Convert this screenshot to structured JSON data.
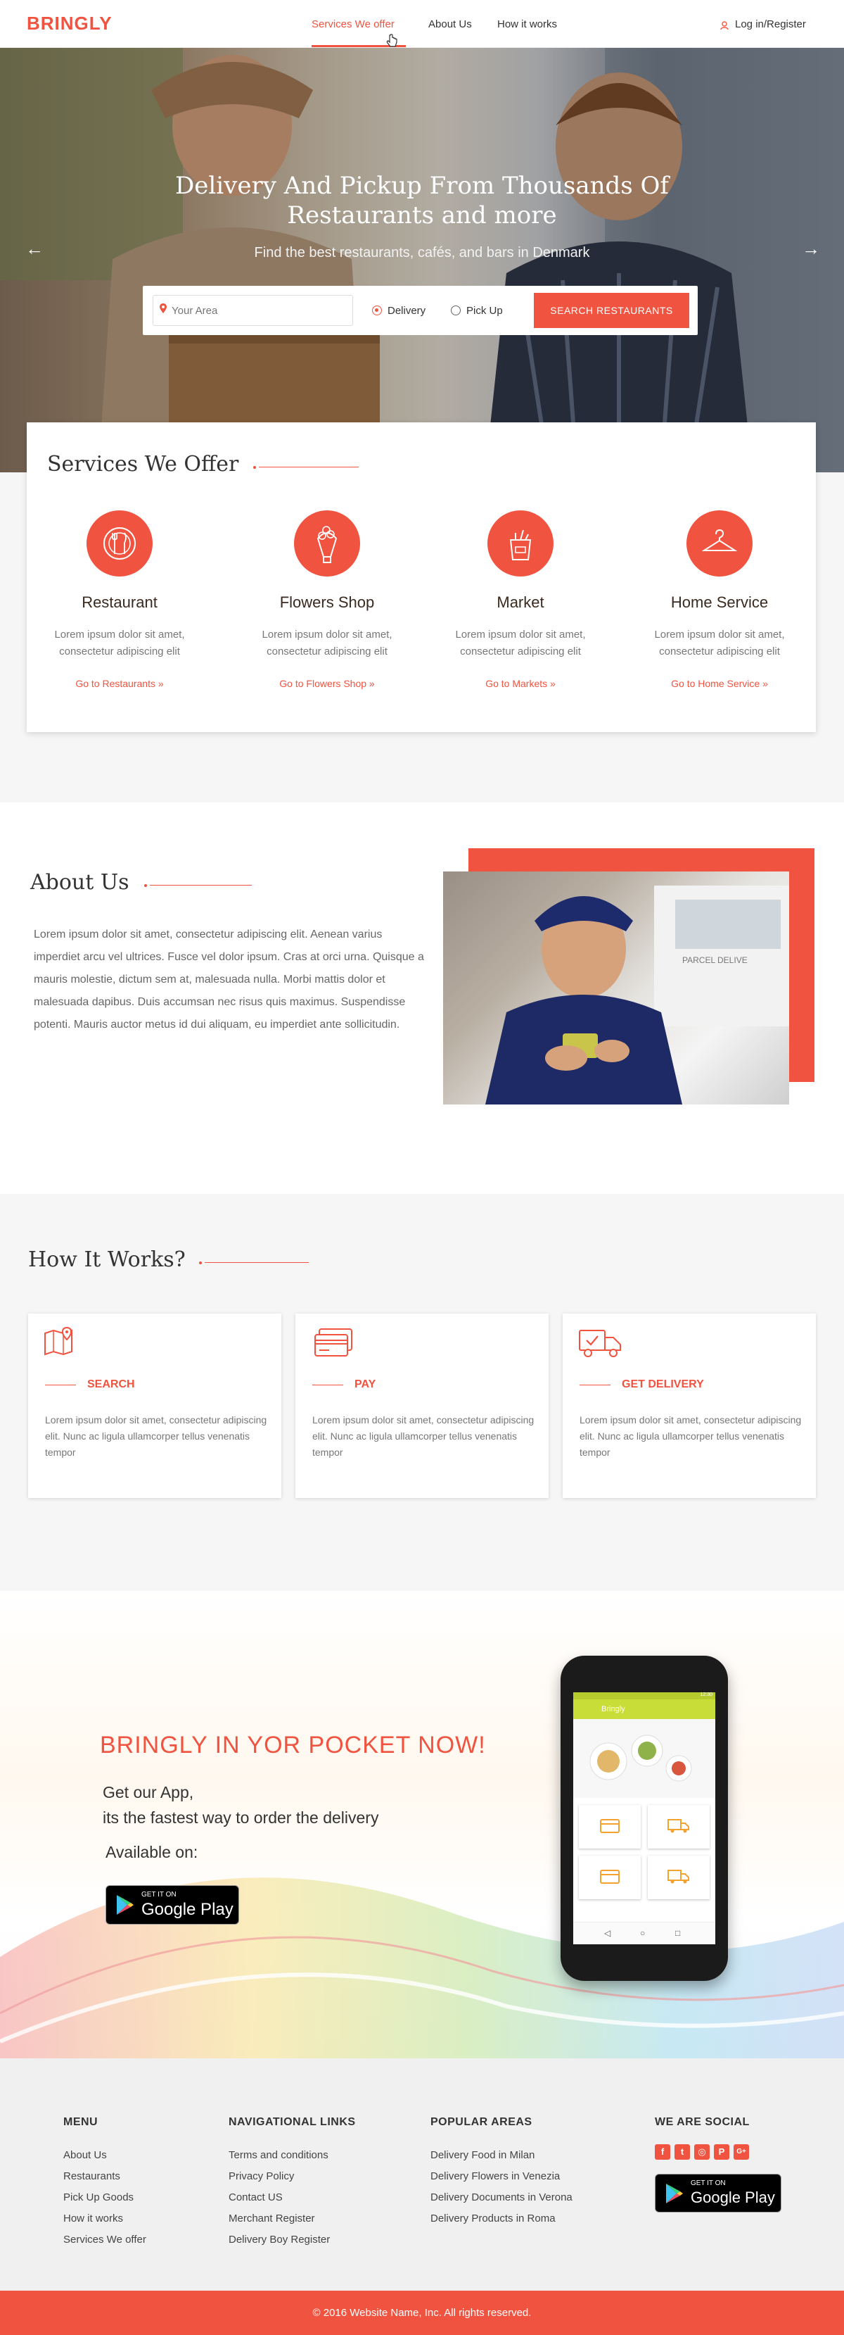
{
  "header": {
    "logo": "BRINGLY",
    "nav": [
      {
        "label": "Services  We offer"
      },
      {
        "label": "About Us"
      },
      {
        "label": "How it works"
      }
    ],
    "login": "Log in/Register"
  },
  "hero": {
    "title": "Delivery And Pickup From Thousands Of Restaurants and more",
    "subtitle": "Find the best restaurants, cafés, and bars in Denmark",
    "search_placeholder": "Your Area",
    "options": [
      "Delivery",
      "Pick Up"
    ],
    "selected_option": "Delivery",
    "search_button": "SEARCH RESTAURANTS",
    "prev_arrow": "←",
    "next_arrow": "→",
    "slides": 3,
    "active_slide": 1
  },
  "services": {
    "title": "Services We Offer",
    "items": [
      {
        "title": "Restaurant",
        "desc": "Lorem ipsum dolor sit amet, consectetur adipiscing elit",
        "link": "Go to Restaurants »",
        "icon": "plate-cutlery-icon"
      },
      {
        "title": "Flowers Shop",
        "desc": "Lorem ipsum dolor sit amet, consectetur adipiscing elit",
        "link": "Go to Flowers Shop »",
        "icon": "bouquet-icon"
      },
      {
        "title": "Market",
        "desc": "Lorem ipsum dolor sit amet, consectetur adipiscing elit",
        "link": "Go to Markets »",
        "icon": "grocery-bag-icon"
      },
      {
        "title": "Home Service",
        "desc": "Lorem ipsum dolor sit amet, consectetur adipiscing elit",
        "link": "Go to Home Service »",
        "icon": "hanger-icon"
      }
    ]
  },
  "about": {
    "title": "About Us",
    "paragraph": "Lorem ipsum dolor sit amet, consectetur adipiscing elit. Aenean varius imperdiet arcu vel ultrices. Fusce vel dolor ipsum. Cras at orci urna. Quisque a mauris molestie, dictum sem at, malesuada nulla. Morbi mattis dolor et malesuada dapibus. Duis accumsan nec risus quis maximus. Suspendisse potenti. Mauris auctor metus id dui aliquam, eu imperdiet ante sollicitudin.",
    "van_text": "PARCEL DELIVE"
  },
  "how": {
    "title": "How It Works?",
    "steps": [
      {
        "label": "SEARCH",
        "desc": "Lorem ipsum dolor sit amet, consectetur adipiscing elit. Nunc ac ligula ullamcorper tellus venenatis tempor",
        "icon": "map-pin-icon"
      },
      {
        "label": "PAY",
        "desc": "Lorem ipsum dolor sit amet, consectetur adipiscing elit. Nunc ac ligula ullamcorper tellus venenatis tempor",
        "icon": "credit-card-icon"
      },
      {
        "label": "GET DELIVERY",
        "desc": "Lorem ipsum dolor sit amet, consectetur adipiscing elit. Nunc ac ligula ullamcorper tellus venenatis tempor",
        "icon": "delivery-truck-icon"
      }
    ]
  },
  "app": {
    "title": "BRINGLY IN YOR POCKET NOW!",
    "line1": "Get our App,",
    "line2": "its the fastest way to order the delivery",
    "available": "Available on:",
    "store_small": "GET IT ON",
    "store_big": "Google Play",
    "phone_app_name": "Bringly",
    "phone_time": "12:30"
  },
  "footer": {
    "columns": [
      {
        "heading": "MENU",
        "links": [
          "About Us",
          "Restaurants",
          "Pick Up Goods",
          "How it works",
          "Services We offer"
        ]
      },
      {
        "heading": "NAVIGATIONAL LINKS",
        "links": [
          "Terms and conditions",
          "Privacy Policy",
          "Contact US",
          "Merchant Register",
          "Delivery Boy Register"
        ]
      },
      {
        "heading": "POPULAR AREAS",
        "links": [
          "Delivery Food in Milan",
          "Delivery Flowers in Venezia",
          "Delivery Documents in Verona",
          "Delivery Products in Roma"
        ]
      }
    ],
    "social_heading": "WE ARE SOCIAL",
    "social": [
      {
        "glyph": "f",
        "icon": "facebook-icon"
      },
      {
        "glyph": "t",
        "icon": "twitter-icon"
      },
      {
        "glyph": "◎",
        "icon": "instagram-icon"
      },
      {
        "glyph": "P",
        "icon": "pinterest-icon"
      },
      {
        "glyph": "G+",
        "icon": "google-plus-icon"
      }
    ],
    "store_small": "GET IT ON",
    "store_big": "Google Play",
    "copyright": "© 2016 Website Name, Inc. All rights reserved."
  },
  "colors": {
    "accent": "#f0533f",
    "text": "#333333",
    "muted": "#777777",
    "section_bg": "#f6f6f6"
  }
}
